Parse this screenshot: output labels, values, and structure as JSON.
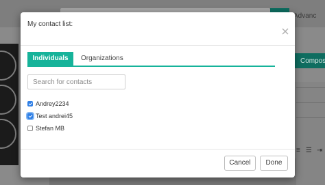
{
  "background": {
    "advanced_label": "Advanc",
    "compose_label": "Compos"
  },
  "modal": {
    "title": "My contact list:",
    "tabs": [
      {
        "label": "Individuals",
        "active": true
      },
      {
        "label": "Organizations",
        "active": false
      }
    ],
    "search": {
      "placeholder": "Search for contacts",
      "value": ""
    },
    "contacts": [
      {
        "name": "Andrey2234",
        "checked": true,
        "focused": false
      },
      {
        "name": "Test andrei45",
        "checked": true,
        "focused": true
      },
      {
        "name": "Stefan MB",
        "checked": false,
        "focused": false
      }
    ],
    "buttons": {
      "cancel": "Cancel",
      "done": "Done"
    }
  },
  "colors": {
    "accent": "#16b39a",
    "checkbox": "#2f7fe6",
    "overlay": "#5e5e5e"
  }
}
